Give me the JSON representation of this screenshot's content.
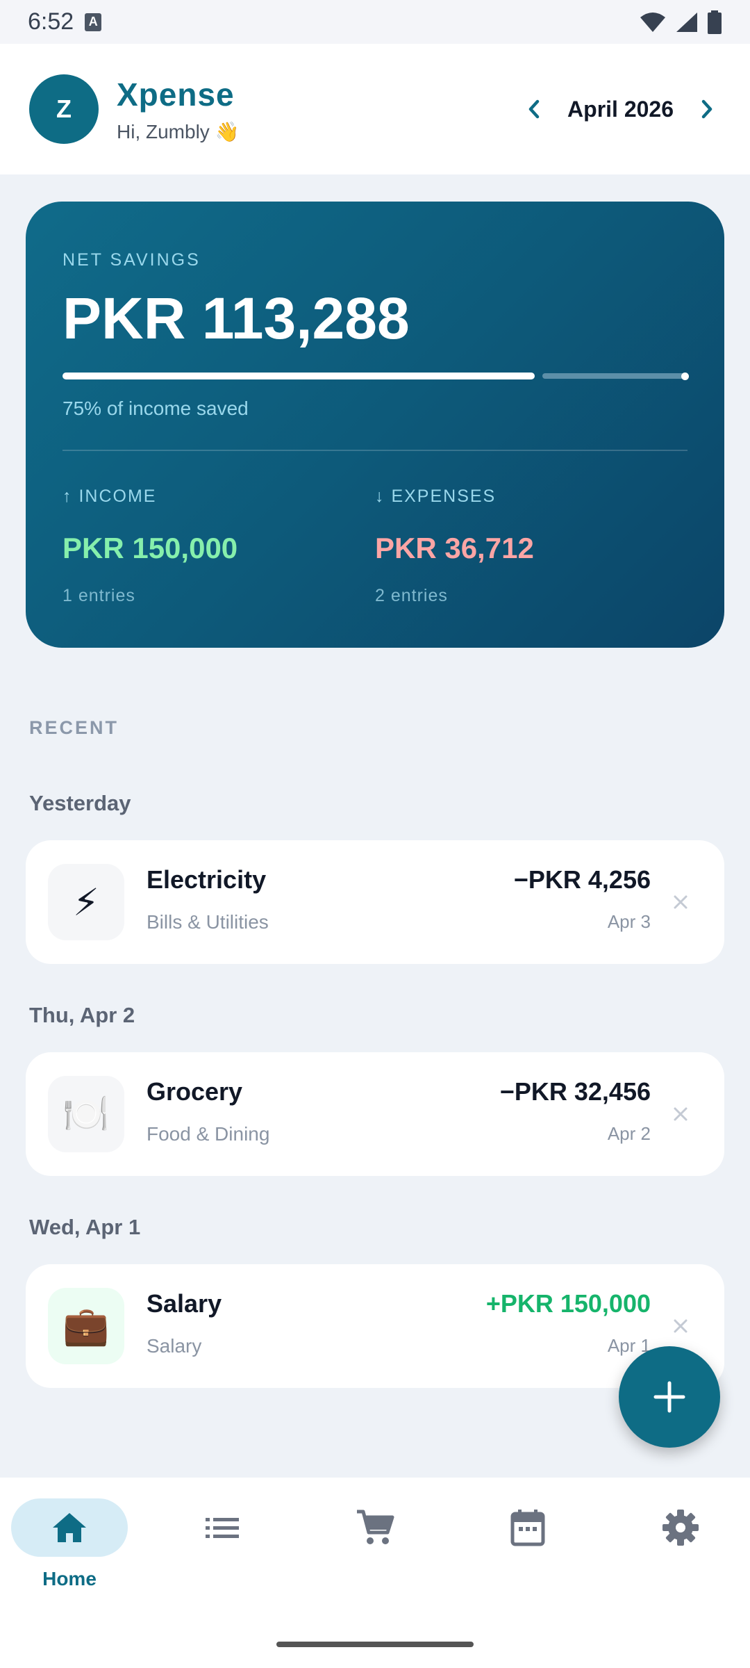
{
  "status": {
    "time": "6:52"
  },
  "header": {
    "avatar_initial": "Z",
    "app_title": "Xpense",
    "greeting": "Hi, Zumbly 👋",
    "month": "April 2026"
  },
  "summary": {
    "net_label": "NET SAVINGS",
    "net_value": "PKR 113,288",
    "saved_percent": 0.75,
    "saved_text": "75% of income saved",
    "income_label": "↑  INCOME",
    "income_value": "PKR 150,000",
    "income_entries": "1 entries",
    "expenses_label": "↓  EXPENSES",
    "expenses_value": "PKR 36,712",
    "expenses_entries": "2 entries"
  },
  "recent": {
    "title": "RECENT",
    "groups": [
      {
        "label": "Yesterday",
        "transaction": {
          "icon": "lightning-icon",
          "emoji": "⚡",
          "title": "Electricity",
          "category": "Bills & Utilities",
          "amount": "−PKR 4,256",
          "date": "Apr 3"
        }
      },
      {
        "label": "Thu, Apr 2",
        "transaction": {
          "icon": "plate-icon",
          "emoji": "🍽️",
          "title": "Grocery",
          "category": "Food & Dining",
          "amount": "−PKR 32,456",
          "date": "Apr 2"
        }
      },
      {
        "label": "Wed, Apr 1",
        "transaction": {
          "icon": "briefcase-icon",
          "emoji": "💼",
          "title": "Salary",
          "category": "Salary",
          "amount": "+PKR 150,000",
          "date": "Apr 1"
        }
      }
    ]
  },
  "nav": {
    "home_label": "Home",
    "items": [
      "home-icon",
      "list-icon",
      "cart-icon",
      "calendar-icon",
      "settings-icon"
    ]
  },
  "colors": {
    "primary": "#0e6c85",
    "income": "#86efac",
    "expense": "#fca5a5",
    "positive": "#16b46b"
  }
}
